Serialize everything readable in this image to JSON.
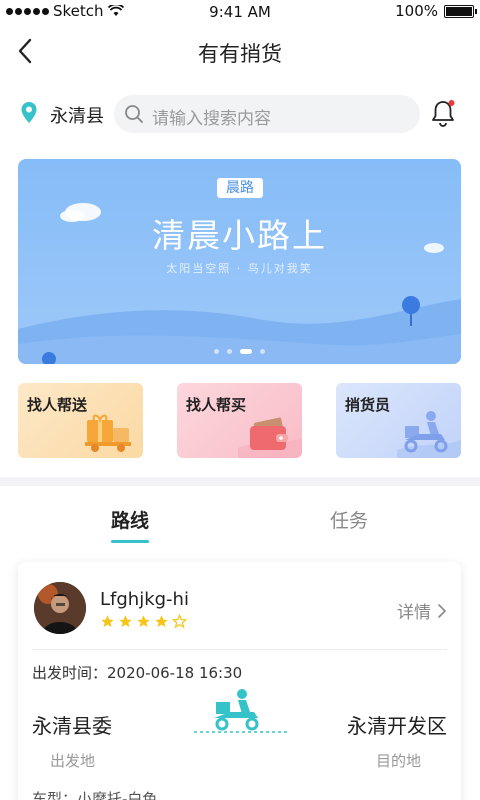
{
  "status_bar": {
    "carrier": "Sketch",
    "time": "9:41 AM",
    "battery": "100%"
  },
  "nav": {
    "title": "有有捎货"
  },
  "search": {
    "location": "永清县",
    "placeholder": "请输入搜索内容"
  },
  "banner": {
    "tag": "晨路",
    "title": "清晨小路上",
    "subtitle": "太阳当空照 · 鸟儿对我笑",
    "page_index": 3,
    "page_count": 4
  },
  "quick_actions": [
    {
      "label": "找人帮送",
      "icon": "gift-truck-icon"
    },
    {
      "label": "找人帮买",
      "icon": "wallet-icon"
    },
    {
      "label": "捎货员",
      "icon": "delivery-scooter-icon"
    }
  ],
  "tabs": [
    {
      "label": "路线",
      "active": true
    },
    {
      "label": "任务",
      "active": false
    }
  ],
  "route_card": {
    "user_name": "Lfghjkg-hi",
    "rating": 4,
    "rating_max": 5,
    "detail_label": "详情",
    "depart_time": "出发时间：2020-06-18 16:30",
    "from_city": "永清县委",
    "from_label": "出发地",
    "to_city": "永清开发区",
    "to_label": "目的地",
    "car_type": "车型：小摩托-白色"
  },
  "colors": {
    "accent": "#35c3c9",
    "banner": "#8fc1f8"
  }
}
